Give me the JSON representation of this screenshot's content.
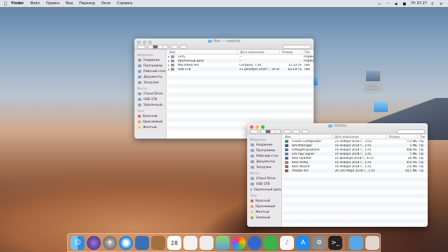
{
  "menubar": {
    "app_name": "Finder",
    "items": [
      "Файл",
      "Правка",
      "Вид",
      "Переход",
      "Окно",
      "Справка"
    ],
    "clock": "Пт 07:27"
  },
  "window_front_left": {
    "title": "Mac — нафизи",
    "sidebar": {
      "favorites_header": "Избранное",
      "favorites": [
        "Недавние",
        "Программы",
        "Рабочий стол",
        "Документы",
        "Загрузки"
      ],
      "places_header": "Места",
      "places": [
        "iCloud Drive",
        "USB 1TB",
        "Удаленный..."
      ],
      "tags_header": "Теги",
      "tags": [
        "Красный",
        "Оранжевый",
        "Желтый"
      ]
    },
    "columns": [
      "Имя",
      "Дата изменения",
      "Размер",
      "Тип"
    ],
    "rows": [
      {
        "name": "Сеть",
        "date": "--",
        "size": "",
        "type": "Перен"
      },
      {
        "name": "Удаленный диск",
        "date": "--",
        "size": "",
        "type": "Перен"
      },
      {
        "name": "Macintosh HD",
        "date": "Сегодня, 7:20",
        "size": "12,33 ТБ",
        "type": "Том"
      },
      {
        "name": "USB 1TB",
        "date": "21 декабря 2018 г., 10:16",
        "size": "623,8 ГБ",
        "type": "Том"
      }
    ]
  },
  "window_utilities": {
    "title": "Utilities",
    "sidebar": {
      "favorites_header": "Избранное",
      "favorites": [
        "Недавние",
        "Программы",
        "Рабочий стол",
        "Документы",
        "Загрузки"
      ],
      "places_header": "Места",
      "places": [
        "iCloud Drive",
        "USB 1TB",
        "Удаленный диск"
      ],
      "tags_header": "Теги",
      "tags": [
        "Красный",
        "Оранжевый",
        "Желтый",
        "Зеленый"
      ]
    },
    "columns": [
      "Имя",
      "Дата изменения",
      "Размер",
      "Тип"
    ],
    "rows": [
      {
        "name": "Clover Configurator",
        "date": "21 ноября 2018 г., 3:53",
        "size": "7,2 МБ",
        "type": "Пр"
      },
      {
        "name": "DPCIManager",
        "date": "16 января 2018 г., 1:41",
        "size": "5 МБ",
        "type": "Пр"
      },
      {
        "name": "IORegistryExplorer",
        "date": "16 января 2018 г., 1:41",
        "size": "498 КБ",
        "type": "Пр"
      },
      {
        "name": "iOS App Signer",
        "date": "16 января 2018 г., 1:41",
        "size": "5 МБ",
        "type": "Пр"
      },
      {
        "name": "Kext Updater",
        "date": "22 декабря 2018 г., 6:51",
        "size": "26 МБ",
        "type": "Пр"
      },
      {
        "name": "Kext Utility",
        "date": "16 января 2018 г., 1:41",
        "size": "452 КБ",
        "type": "Пр"
      },
      {
        "name": "Kext Wizard",
        "date": "16 января 2018 г., 1:41",
        "size": "2,6 МБ",
        "type": "Пр"
      },
      {
        "name": "PhotoB Pro",
        "date": "26 сентября 2018 г., 1:41",
        "size": "18,1 МБ",
        "type": "Пр"
      }
    ]
  },
  "desktop": {
    "folder_label": "Utilities"
  },
  "dock": {
    "apps": [
      "finder-icon",
      "siri-icon",
      "launchpad-icon",
      "safari-icon",
      "preview-icon",
      "notes-icon",
      "calendar-icon",
      "textedit-icon",
      "reminders-icon",
      "maps-icon",
      "photos-icon",
      "messages-icon",
      "facetime-icon",
      "itunes-icon",
      "appstore-icon",
      "system-preferences-icon",
      "terminal-icon",
      "downloads-folder-icon",
      "trash-icon"
    ],
    "calendar_day": "28"
  }
}
